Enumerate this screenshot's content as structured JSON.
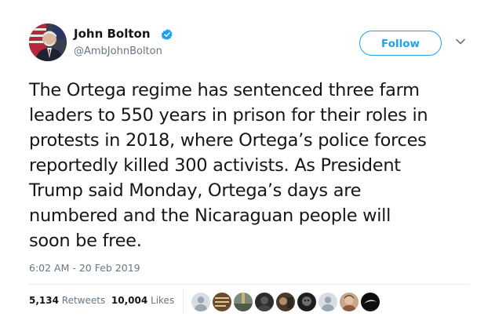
{
  "author": {
    "name": "John Bolton",
    "handle": "@AmbJohnBolton",
    "verified_icon": "verified-badge-icon"
  },
  "follow_button": {
    "label": "Follow"
  },
  "menu_caret": {
    "icon": "chevron-down-icon"
  },
  "tweet": {
    "lines": [
      "The Ortega regime has sentenced three farm",
      "leaders to 550 years in prison for their roles in",
      "protests in 2018, where Ortega’s police forces",
      "reportedly killed 300 activists. As President",
      "Trump said Monday, Ortega’s days are",
      "numbered and the Nicaraguan people will",
      "soon be free."
    ],
    "timestamp": "6:02 AM - 20 Feb 2019"
  },
  "stats": {
    "retweets_count": "5,134",
    "retweets_label": "Retweets",
    "likes_count": "10,004",
    "likes_label": "Likes"
  },
  "colors": {
    "accent": "#1da1f2",
    "text": "#14171a",
    "secondary": "#657786",
    "divider": "#e6ecf0"
  }
}
